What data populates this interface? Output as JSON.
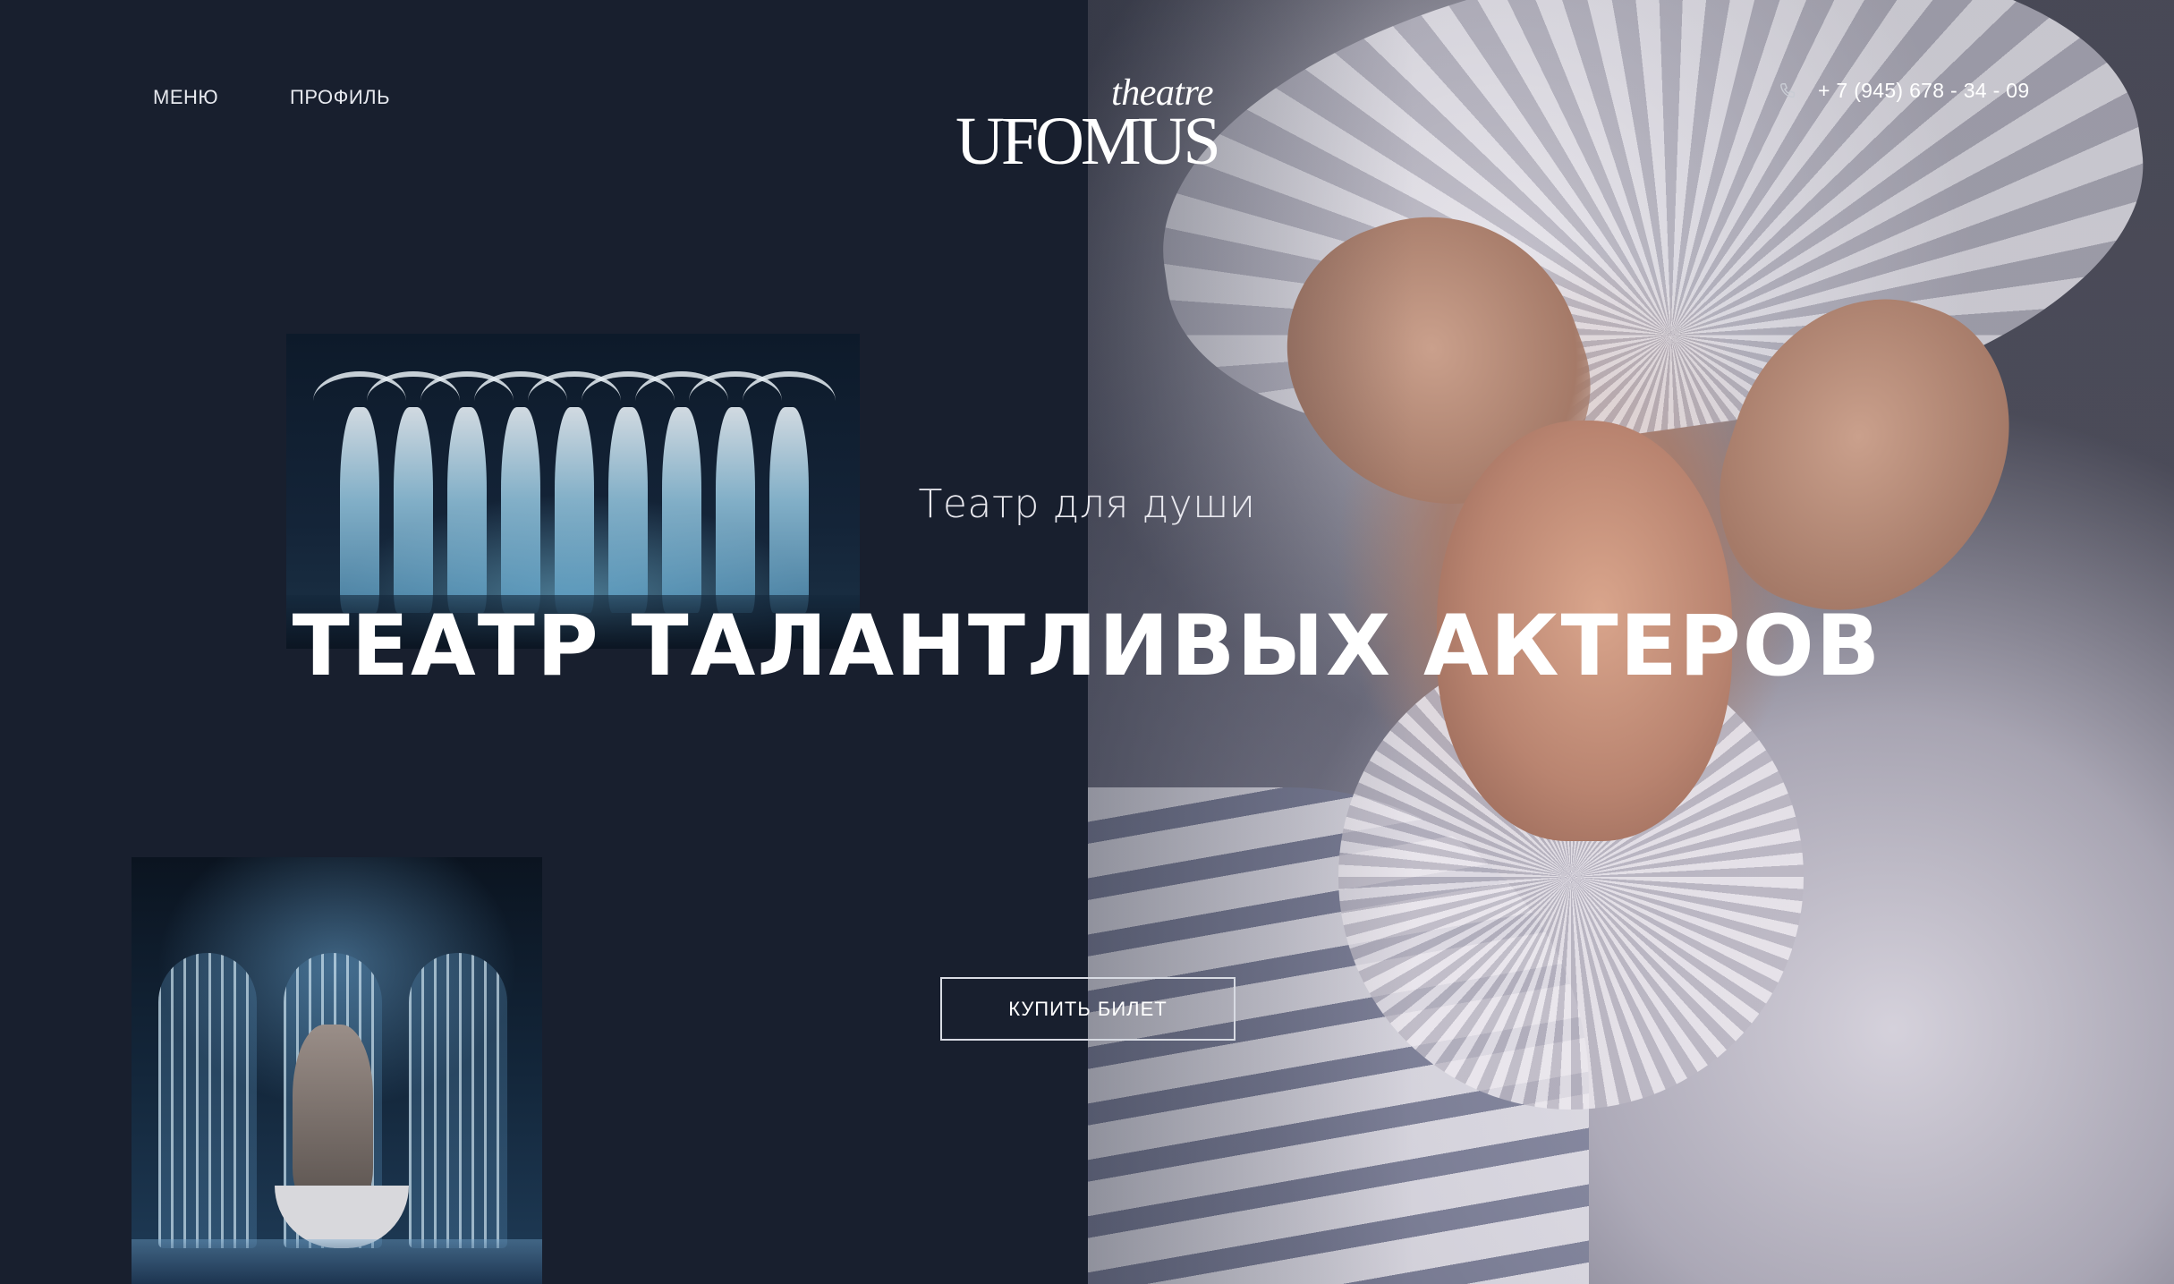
{
  "header": {
    "nav": [
      {
        "label": "МЕНЮ"
      },
      {
        "label": "ПРОФИЛЬ"
      }
    ],
    "logo": {
      "small": "theatre",
      "big": "UFOMUS"
    },
    "phone": {
      "icon": "phone-icon",
      "number": "+ 7 (945) 678 - 34 - 09"
    }
  },
  "hero": {
    "subtitle": "Театр для души",
    "title": "ТЕАТР ТАЛАНТЛИВЫХ АКТЕРОВ",
    "cta_label": "КУПИТЬ БИЛЕТ"
  },
  "colors": {
    "background": "#181f2e",
    "text": "#ffffff",
    "button_border": "#d8dbe3"
  }
}
